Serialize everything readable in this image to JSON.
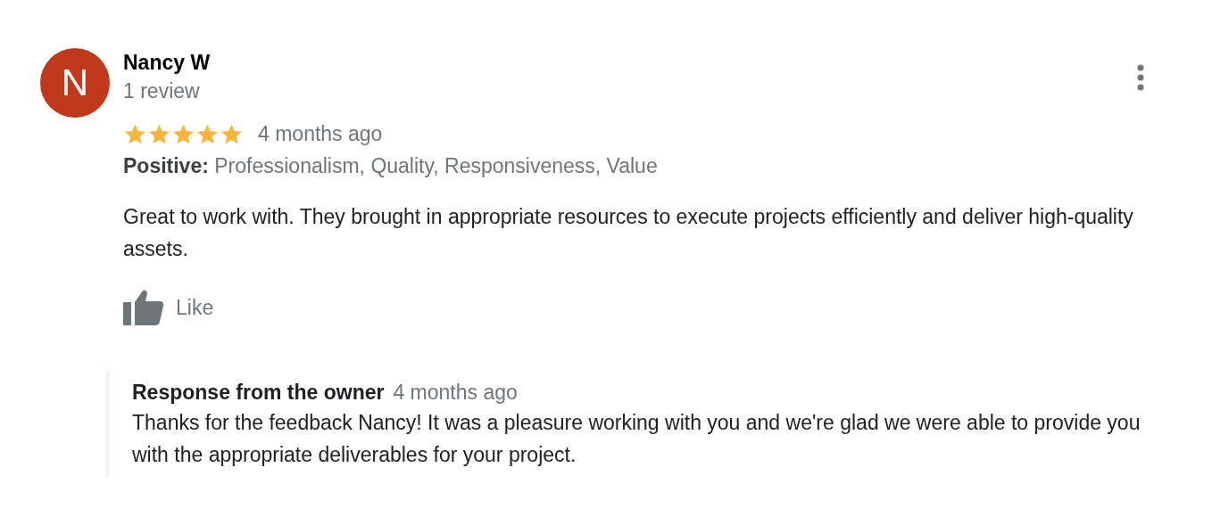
{
  "review": {
    "avatar_letter": "N",
    "author": "Nancy W",
    "review_count": "1 review",
    "stars": 5,
    "time": "4 months ago",
    "positive": "**Positive:** Professionalism, Quality, Responsiveness, Value",
    "text": "Great to work with. They brought in appropriate resources to execute projects efficiently and deliver high-quality assets.",
    "like_label": "Like"
  },
  "owner_response": {
    "title": "Response from the owner",
    "time": "4 months ago",
    "text": "Thanks for the feedback Nancy! It was a pleasure working with you and we're glad we were able to provide you with the appropriate deliverables for your project."
  }
}
